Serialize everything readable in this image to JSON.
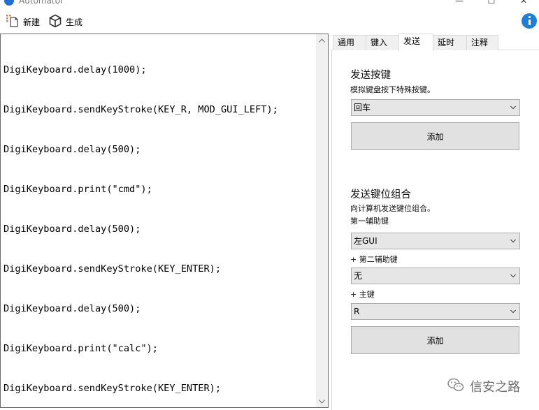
{
  "window": {
    "title": "Automator",
    "minimize": "—",
    "maximize": "☐",
    "close": "✕"
  },
  "toolbar": {
    "new_label": "新建",
    "new_icon": "new-file-icon",
    "generate_label": "生成",
    "generate_icon": "cube-icon",
    "info_icon": "info-icon"
  },
  "editor": {
    "lines": [
      "DigiKeyboard.delay(1000);",
      "DigiKeyboard.sendKeyStroke(KEY_R, MOD_GUI_LEFT);",
      "DigiKeyboard.delay(500);",
      "DigiKeyboard.print(\"cmd\");",
      "DigiKeyboard.delay(500);",
      "DigiKeyboard.sendKeyStroke(KEY_ENTER);",
      "DigiKeyboard.delay(500);",
      "DigiKeyboard.print(\"calc\");",
      "DigiKeyboard.sendKeyStroke(KEY_ENTER);"
    ]
  },
  "tabs": [
    {
      "label": "通用",
      "active": false
    },
    {
      "label": "键入",
      "active": false
    },
    {
      "label": "发送",
      "active": true
    },
    {
      "label": "延时",
      "active": false
    },
    {
      "label": "注释",
      "active": false
    }
  ],
  "send_key": {
    "title": "发送按键",
    "description": "模拟键盘按下特殊按键。",
    "selected": "回车",
    "add_label": "添加"
  },
  "send_combo": {
    "title": "发送键位组合",
    "description": "向计算机发送键位组合。",
    "modifier1_label": "第一辅助键",
    "modifier1_value": "左GUI",
    "modifier2_label": "+ 第二辅助键",
    "modifier2_value": "无",
    "main_key_label": "+ 主键",
    "main_key_value": "R",
    "add_label": "添加"
  },
  "watermark": {
    "text": "信安之路",
    "icon": "wechat-icon"
  },
  "colors": {
    "accent": "#1e7fd8",
    "control_bg": "#e1e1e1",
    "tab_bg": "#f0f0f0"
  }
}
